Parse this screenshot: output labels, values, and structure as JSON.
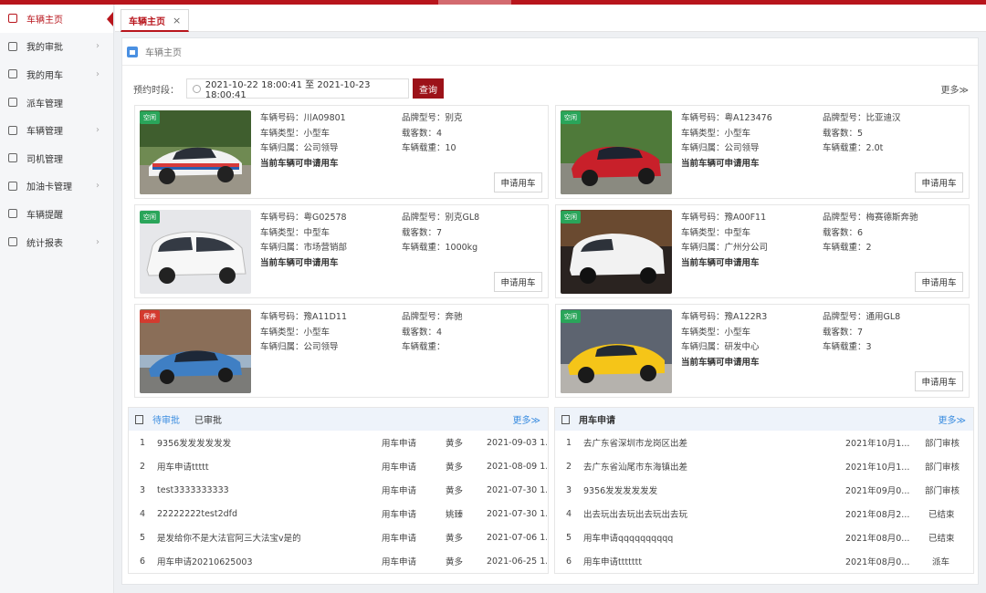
{
  "sidebar": {
    "items": [
      {
        "label": "车辆主页",
        "arrow": "",
        "active": true
      },
      {
        "label": "我的审批",
        "arrow": "›"
      },
      {
        "label": "我的用车",
        "arrow": "›"
      },
      {
        "label": "派车管理",
        "arrow": ""
      },
      {
        "label": "车辆管理",
        "arrow": "›"
      },
      {
        "label": "司机管理",
        "arrow": ""
      },
      {
        "label": "加油卡管理",
        "arrow": "›"
      },
      {
        "label": "车辆提醒",
        "arrow": ""
      },
      {
        "label": "统计报表",
        "arrow": "›"
      }
    ]
  },
  "tab": {
    "label": "车辆主页",
    "close": "×"
  },
  "breadcrumb": "车辆主页",
  "filter": {
    "label": "预约时段：",
    "range": "2021-10-22 18:00:41 至 2021-10-23 18:00:41",
    "query_label": "查询",
    "more": "更多≫"
  },
  "cards": [
    {
      "status": "空闲",
      "plate": "车辆号码：川A09801",
      "brand": "品牌型号：别克",
      "type": "车辆类型：小型车",
      "seats": "载客数：4",
      "owner": "车辆归属：公司领导",
      "load": "车辆载重：10",
      "avail": "当前车辆可申请用车",
      "apply": "申请用车"
    },
    {
      "status": "空闲",
      "plate": "车辆号码：粤A123476",
      "brand": "品牌型号：比亚迪汉",
      "type": "车辆类型：小型车",
      "seats": "载客数：5",
      "owner": "车辆归属：公司领导",
      "load": "车辆载重：2.0t",
      "avail": "当前车辆可申请用车",
      "apply": "申请用车"
    },
    {
      "status": "空闲",
      "plate": "车辆号码：粤G02578",
      "brand": "品牌型号：别克GL8",
      "type": "车辆类型：中型车",
      "seats": "载客数：7",
      "owner": "车辆归属：市场营销部",
      "load": "车辆载重：1000kg",
      "avail": "当前车辆可申请用车",
      "apply": "申请用车"
    },
    {
      "status": "空闲",
      "plate": "车辆号码：豫A00F11",
      "brand": "品牌型号：梅赛德斯奔驰",
      "type": "车辆类型：中型车",
      "seats": "载客数：6",
      "owner": "车辆归属：广州分公司",
      "load": "车辆载重：2",
      "avail": "当前车辆可申请用车",
      "apply": "申请用车"
    },
    {
      "status": "保养",
      "plate": "车辆号码：豫A11D11",
      "brand": "品牌型号：奔驰",
      "type": "车辆类型：小型车",
      "seats": "载客数：4",
      "owner": "车辆归属：公司领导",
      "load": "车辆载重：",
      "avail": "",
      "apply": ""
    },
    {
      "status": "空闲",
      "plate": "车辆号码：豫A122R3",
      "brand": "品牌型号：通用GL8",
      "type": "车辆类型：小型车",
      "seats": "载客数：7",
      "owner": "车辆归属：研发中心",
      "load": "车辆载重：3",
      "avail": "当前车辆可申请用车",
      "apply": "申请用车"
    }
  ],
  "approvals": {
    "tab_pending": "待审批",
    "tab_done": "已审批",
    "more": "更多≫",
    "rows": [
      {
        "no": "1",
        "title": "9356发发发发发发",
        "kind": "用车申请",
        "user": "黄多",
        "date": "2021-09-03 1..."
      },
      {
        "no": "2",
        "title": "用车申请ttttt",
        "kind": "用车申请",
        "user": "黄多",
        "date": "2021-08-09 1..."
      },
      {
        "no": "3",
        "title": "test3333333333",
        "kind": "用车申请",
        "user": "黄多",
        "date": "2021-07-30 1..."
      },
      {
        "no": "4",
        "title": "22222222test2dfd",
        "kind": "用车申请",
        "user": "姚臻",
        "date": "2021-07-30 1..."
      },
      {
        "no": "5",
        "title": "是发给你不是大法官阿三大法宝v是的",
        "kind": "用车申请",
        "user": "黄多",
        "date": "2021-07-06 1..."
      },
      {
        "no": "6",
        "title": "用车申请20210625003",
        "kind": "用车申请",
        "user": "黄多",
        "date": "2021-06-25 1..."
      }
    ]
  },
  "requests": {
    "title": "用车申请",
    "more": "更多≫",
    "rows": [
      {
        "no": "1",
        "title": "去广东省深圳市龙岗区出差",
        "date": "2021年10月1...",
        "status": "部门审核"
      },
      {
        "no": "2",
        "title": "去广东省汕尾市东海镇出差",
        "date": "2021年10月1...",
        "status": "部门审核"
      },
      {
        "no": "3",
        "title": "9356发发发发发发",
        "date": "2021年09月0...",
        "status": "部门审核"
      },
      {
        "no": "4",
        "title": "出去玩出去玩出去玩出去玩",
        "date": "2021年08月2...",
        "status": "已结束"
      },
      {
        "no": "5",
        "title": "用车申请qqqqqqqqqq",
        "date": "2021年08月0...",
        "status": "已结束"
      },
      {
        "no": "6",
        "title": "用车申请ttttttt",
        "date": "2021年08月0...",
        "status": "派车"
      }
    ]
  }
}
